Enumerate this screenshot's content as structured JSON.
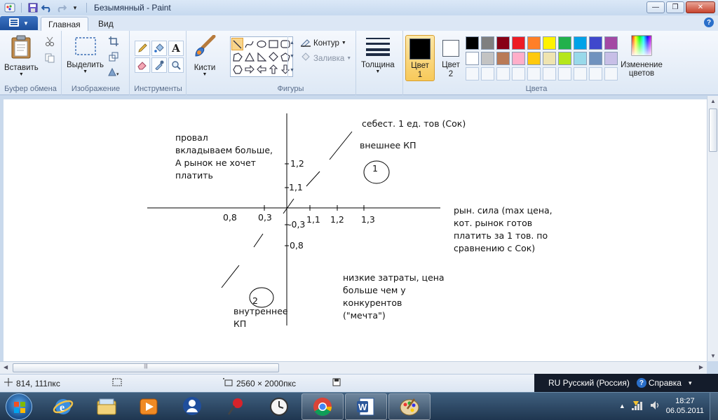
{
  "window": {
    "title": "Безымянный - Paint"
  },
  "ribbon_tabs": {
    "home": "Главная",
    "view": "Вид"
  },
  "ribbon": {
    "clipboard": {
      "paste": "Вставить",
      "group": "Буфер обмена"
    },
    "image": {
      "select": "Выделить",
      "group": "Изображение"
    },
    "tools": {
      "group": "Инструменты",
      "text_glyph": "A"
    },
    "brushes": {
      "label": "Кисти"
    },
    "shapes": {
      "outline": "Контур",
      "fill": "Заливка",
      "group": "Фигуры"
    },
    "size": {
      "label": "Толщина"
    },
    "colors": {
      "color1_line1": "Цвет",
      "color1_line2": "1",
      "color2_line1": "Цвет",
      "color2_line2": "2",
      "edit_line1": "Изменение",
      "edit_line2": "цветов",
      "group": "Цвета",
      "color1": "#000000",
      "color2": "#ffffff",
      "palette": [
        "#000000",
        "#7f7f7f",
        "#880015",
        "#ed1c24",
        "#ff7f27",
        "#fff200",
        "#22b14c",
        "#00a2e8",
        "#3f48cc",
        "#a349a4",
        "#ffffff",
        "#c3c3c3",
        "#b97a57",
        "#ffaec9",
        "#ffc90e",
        "#efe4b0",
        "#b5e61d",
        "#99d9ea",
        "#7092be",
        "#c8bfe7"
      ]
    }
  },
  "canvas": {
    "texts": {
      "top_left_1": "провал",
      "top_left_2": "вкладываем больше,",
      "top_left_3": "А рынок не хочет",
      "top_left_4": "платить",
      "sebest": "себест. 1 ед. тов (Сок)",
      "external": "внешнее КП",
      "circle1": "1",
      "y_12": "1,2",
      "y_11": "1,1",
      "x_08": "0,8",
      "x_03": "0,3",
      "y_m03": "-0,3",
      "x_11": "1,1",
      "x_12": "1,2",
      "x_13": "1,3",
      "y_08": "0,8",
      "right_1": "рын. сила (max цена,",
      "right_2": "кот. рынок готов",
      "right_3": "платить за 1 тов. по",
      "right_4": "сравнению с Сок)",
      "bottom_right_1": "низкие затраты, цена",
      "bottom_right_2": "больше чем у",
      "bottom_right_3": "конкурентов",
      "bottom_right_4": "(\"мечта\")",
      "circle2": "2",
      "internal_1": "внутреннее",
      "internal_2": "КП"
    }
  },
  "status": {
    "cursor": "814, 111пкс",
    "image_size": "2560 × 2000пкс"
  },
  "langbar": {
    "language": "RU Русский (Россия)",
    "help": "Справка"
  },
  "taskbar": {
    "time": "18:27",
    "date": "06.05.2011"
  }
}
